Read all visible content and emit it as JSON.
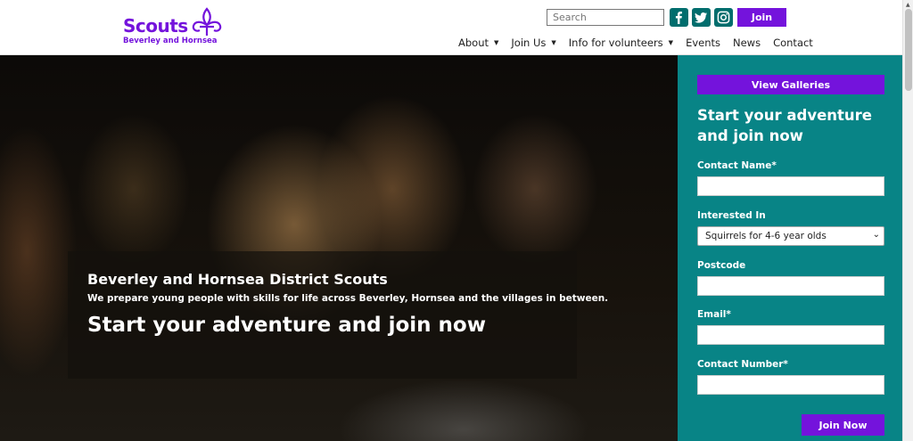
{
  "header": {
    "logo_word": "Scouts",
    "logo_subtitle": "Beverley and Hornsea",
    "search_placeholder": "Search",
    "join_label": "Join",
    "social": [
      {
        "name": "facebook-icon"
      },
      {
        "name": "twitter-icon"
      },
      {
        "name": "instagram-icon"
      }
    ],
    "nav": [
      {
        "label": "About",
        "dropdown": true
      },
      {
        "label": "Join Us",
        "dropdown": true
      },
      {
        "label": "Info for volunteers",
        "dropdown": true
      },
      {
        "label": "Events",
        "dropdown": false
      },
      {
        "label": "News",
        "dropdown": false
      },
      {
        "label": "Contact",
        "dropdown": false
      }
    ],
    "caret": "▼"
  },
  "hero": {
    "title": "Beverley and Hornsea District Scouts",
    "subtitle": "We prepare young people with skills for life across Beverley, Hornsea and the villages in between.",
    "cta": "Start your adventure and join now"
  },
  "panel": {
    "view_galleries": "View Galleries",
    "heading": "Start your adventure and join now",
    "fields": {
      "contact_name": "Contact Name*",
      "interested_in": "Interested In",
      "interested_value": "Squirrels for 4-6 year olds",
      "postcode": "Postcode",
      "email": "Email*",
      "contact_number": "Contact Number*"
    },
    "submit": "Join Now"
  },
  "colors": {
    "brand_purple": "#7413dc",
    "teal": "#088486",
    "social_teal": "#006d6d"
  }
}
